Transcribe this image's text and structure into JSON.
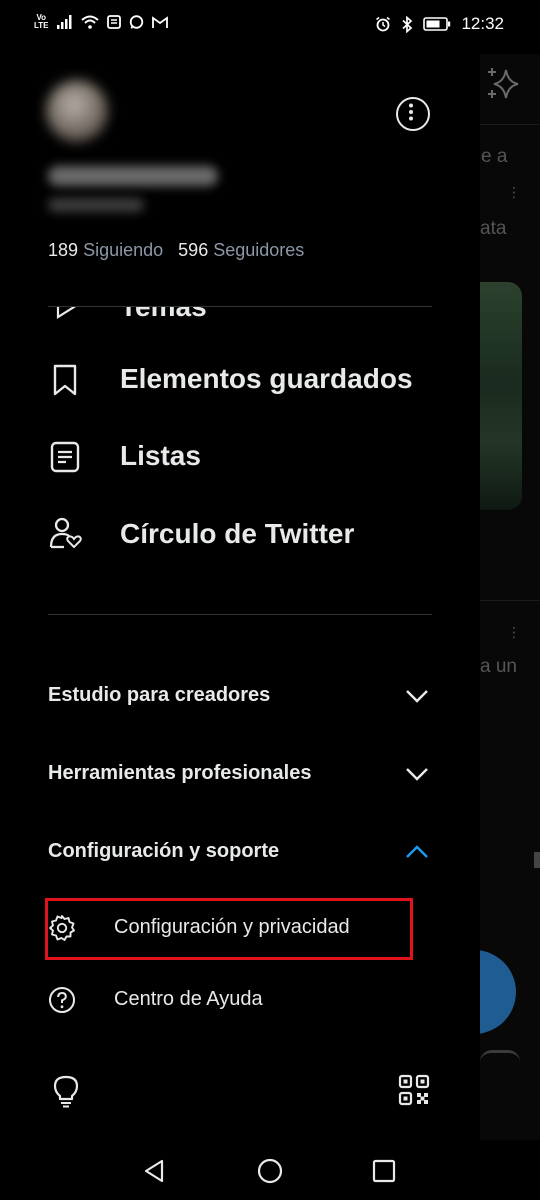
{
  "status_bar": {
    "volte_top": "Vo",
    "volte_bottom": "LTE",
    "time": "12:32"
  },
  "profile": {
    "following_count": "189",
    "following_label": "Siguiendo",
    "followers_count": "596",
    "followers_label": "Seguidores"
  },
  "menu": {
    "partial_item": "Temas",
    "items": [
      {
        "label": "Elementos guardados",
        "icon": "bookmark-icon"
      },
      {
        "label": "Listas",
        "icon": "list-icon"
      },
      {
        "label": "Círculo de Twitter",
        "icon": "twitter-circle-icon"
      }
    ]
  },
  "sections": [
    {
      "label": "Estudio para creadores",
      "expanded": false
    },
    {
      "label": "Herramientas profesionales",
      "expanded": false
    },
    {
      "label": "Configuración y soporte",
      "expanded": true
    }
  ],
  "support_items": [
    {
      "label": "Configuración y privacidad",
      "icon": "gear-icon",
      "highlighted": true
    },
    {
      "label": "Centro de Ayuda",
      "icon": "help-icon",
      "highlighted": false
    }
  ],
  "background": {
    "text_1": "e a",
    "text_2": "ata",
    "text_3": "a un"
  },
  "colors": {
    "accent": "#1d9bf0",
    "highlight_box": "#e0131d",
    "secondary_text": "#8b98a5"
  }
}
